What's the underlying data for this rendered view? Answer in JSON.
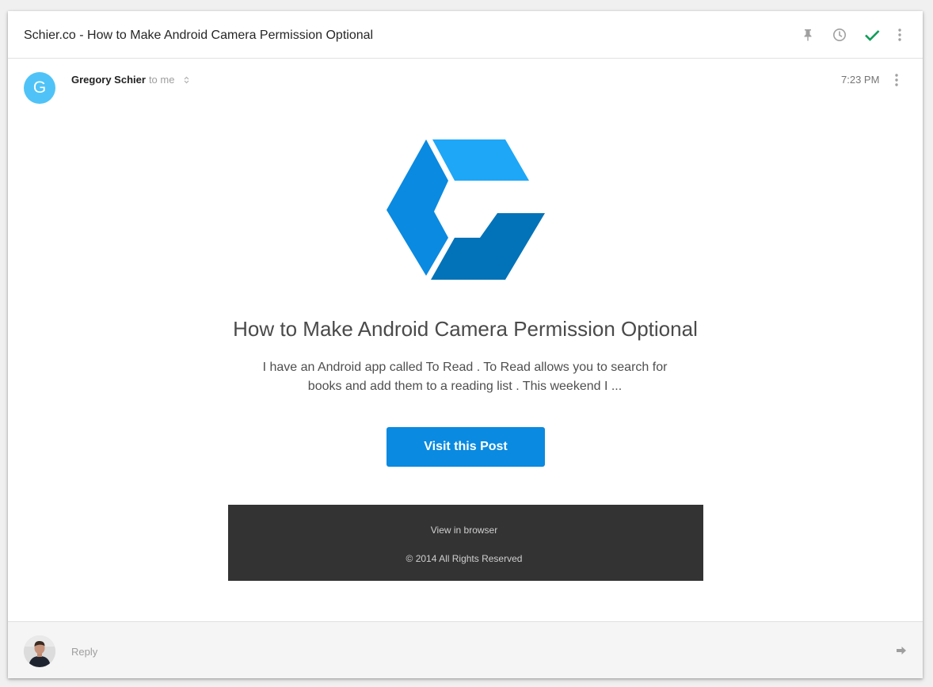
{
  "email": {
    "subject": "Schier.co - How to Make Android Camera Permission Optional",
    "toolbar": {
      "icons": [
        "pin-icon",
        "clock-icon",
        "check-icon",
        "more-vert-icon"
      ],
      "check_color": "#0f9d58",
      "icon_color": "#a0a0a0"
    },
    "message": {
      "avatar_letter": "G",
      "avatar_color": "#4fc3f7",
      "sender_name": "Gregory Schier",
      "recipient": "to me",
      "time": "7:23 PM"
    },
    "body": {
      "logo": "schier-co-logo",
      "logo_colors": [
        "#0a8ae0",
        "#1ea7f7",
        "#0273b8"
      ],
      "title": "How to Make Android Camera Permission Optional",
      "excerpt": "I have an Android app called To Read . To Read allows you to search for books and add them to a reading list . This weekend I ...",
      "button_label": "Visit this Post",
      "button_color": "#0a8ae0",
      "footer": {
        "view_in_browser": "View in browser",
        "copyright": "© 2014 All Rights Reserved",
        "background": "#333333"
      }
    },
    "reply": {
      "placeholder": "Reply",
      "send_icon": "reply-arrow-icon"
    }
  }
}
